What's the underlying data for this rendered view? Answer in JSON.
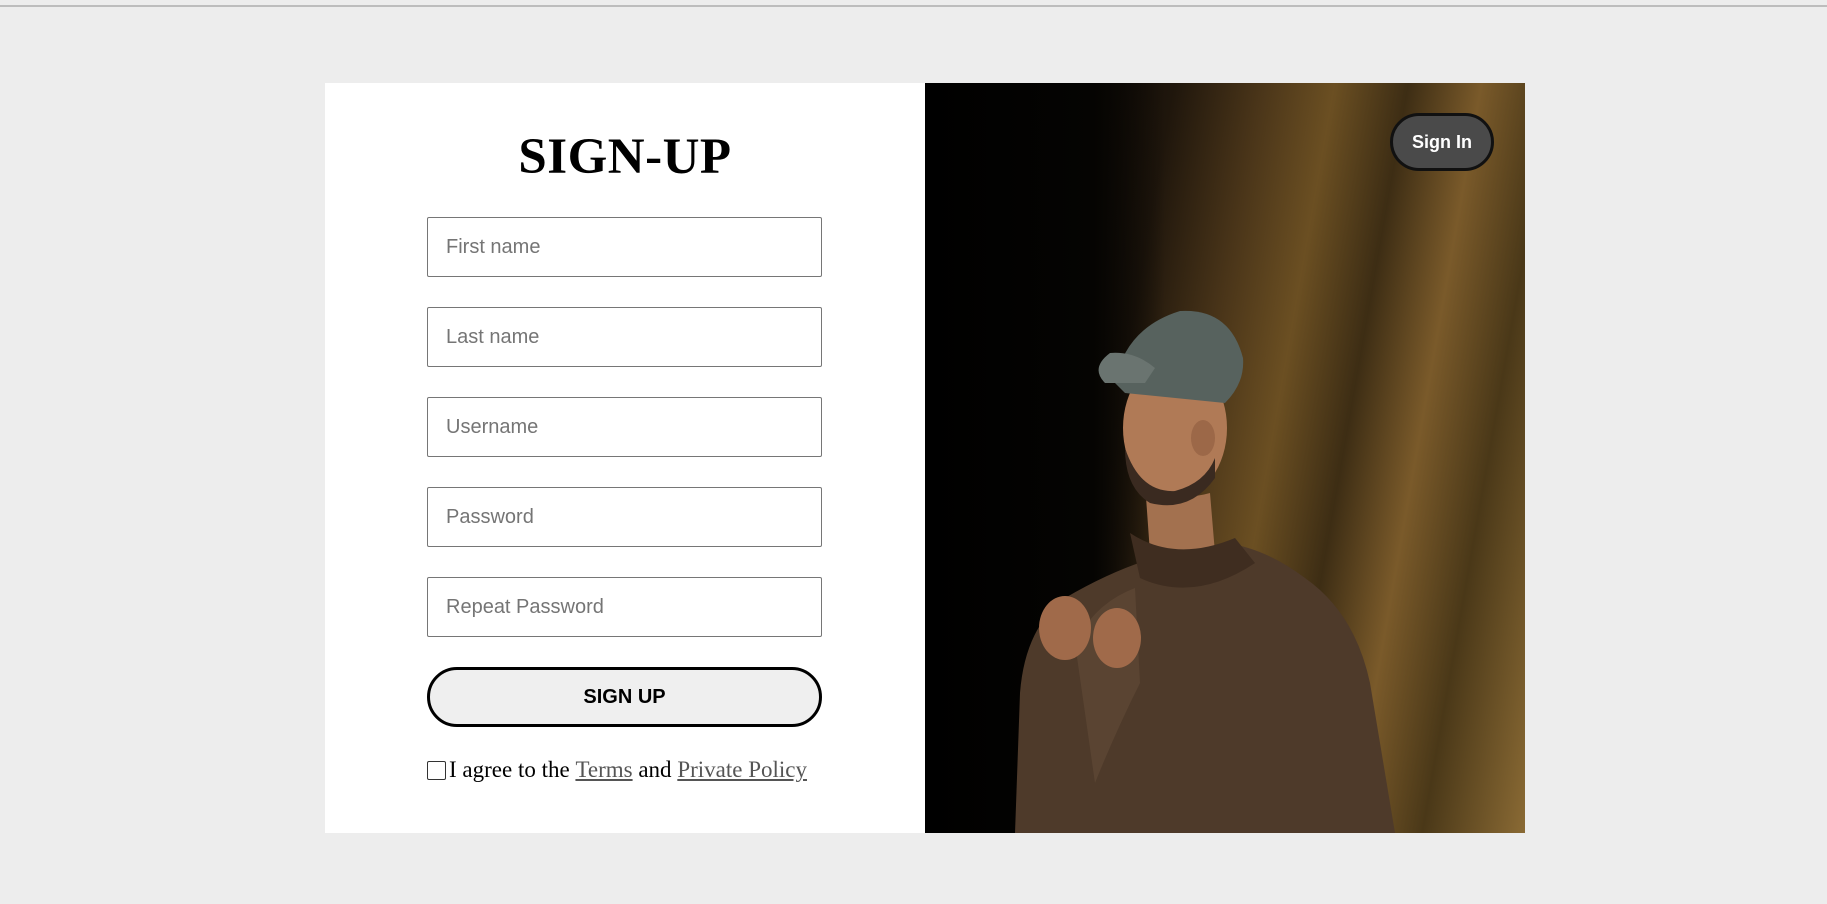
{
  "signup": {
    "title": "SIGN-UP",
    "fields": {
      "first_name": "First name",
      "last_name": "Last name",
      "username": "Username",
      "password": "Password",
      "repeat_password": "Repeat Password"
    },
    "submit_label": "SIGN UP",
    "agree": {
      "prefix": "I agree to the",
      "terms_link": "Terms",
      "and_text": "and",
      "privacy_link": "Private Policy",
      "checked": false
    }
  },
  "photo": {
    "sign_in_label": "Sign In",
    "subject": "man in cap and brown jacket in a cave"
  },
  "colors": {
    "page_bg": "#ededed",
    "sign_in_bg": "#4a4a4a",
    "submit_bg": "#efefef"
  }
}
